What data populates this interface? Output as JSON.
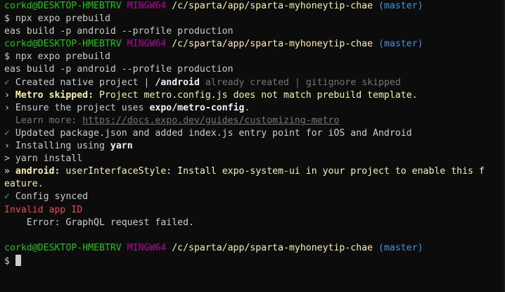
{
  "prompt": {
    "user_host": "corkd@DESKTOP-HMEBTRV",
    "env": "MINGW64",
    "path": "/c/sparta/app/sparta-myhoneytip-chae",
    "branch": "(master)",
    "symbol": "$"
  },
  "lines": {
    "cmd1": "npx expo prebuild",
    "cmd1b": "eas build -p android --profile production",
    "cmd2": "npx expo prebuild",
    "cmd2b": "eas build -p android --profile production",
    "created_check": "✓",
    "created_text": "Created native project |",
    "created_android": "/android",
    "created_rest": "already created | gitignore skipped",
    "metro_arrow": "›",
    "metro_label": "Metro skipped:",
    "metro_text": "Project metro.config.js does not match prebuild template.",
    "ensure_arrow": "›",
    "ensure_text": "Ensure the project uses",
    "ensure_pkg": "expo/metro-config",
    "ensure_dot": ".",
    "learn_text": "Learn more:",
    "learn_url": "https://docs.expo.dev/guides/customizing-metro",
    "updated_check": "✓",
    "updated_text": "Updated package.json and added index.js entry point for iOS and Android",
    "installing_arrow": "›",
    "installing_text": "Installing using",
    "installing_tool": "yarn",
    "yarn_arrow": ">",
    "yarn_text": "yarn install",
    "android_arrow": "»",
    "android_label": "android:",
    "android_text": "userInterfaceStyle: Install expo-system-ui in your project to enable this f",
    "android_wrap": "eature.",
    "synced_check": "✓",
    "synced_text": "Config synced",
    "invalid_text": "Invalid app ID",
    "error_text": "Error: GraphQL request failed."
  },
  "colors": {
    "background": "#0c0c0c",
    "green": "#16c60c",
    "purple": "#b4009e",
    "yellow": "#f9f1a5",
    "cyan": "#3a96dd",
    "red": "#e74856"
  }
}
